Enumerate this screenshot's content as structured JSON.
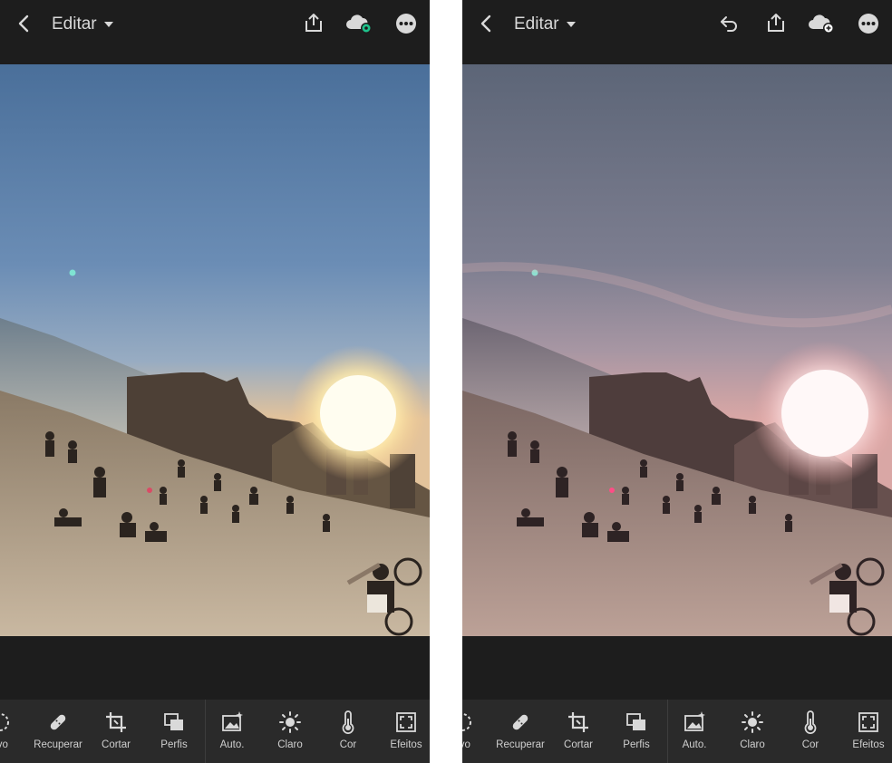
{
  "screens": [
    {
      "id": "original",
      "topbar": {
        "title": "Editar",
        "icons": [
          "back-arrow-icon",
          "share-icon",
          "cloud-sync-icon",
          "more-options-icon"
        ],
        "cloud_badge_color": "#1ec28b"
      },
      "toolbar": {
        "tools": [
          {
            "label": "tivo",
            "icon": "selective-icon"
          },
          {
            "label": "Recuperar",
            "icon": "healing-bandage-icon"
          },
          {
            "label": "Cortar",
            "icon": "crop-icon"
          },
          {
            "label": "Perfis",
            "icon": "profiles-icon"
          },
          {
            "label": "Auto.",
            "icon": "auto-enhance-icon"
          },
          {
            "label": "Claro",
            "icon": "light-sun-icon"
          },
          {
            "label": "Cor",
            "icon": "color-thermometer-icon"
          },
          {
            "label": "Efeitos",
            "icon": "effects-icon"
          }
        ]
      }
    },
    {
      "id": "edited",
      "topbar": {
        "title": "Editar",
        "icons": [
          "back-arrow-icon",
          "undo-icon",
          "share-icon",
          "cloud-add-icon",
          "more-options-icon"
        ],
        "cloud_badge_color": "#ffffff"
      },
      "toolbar": {
        "tools": [
          {
            "label": "tivo",
            "icon": "selective-icon"
          },
          {
            "label": "Recuperar",
            "icon": "healing-bandage-icon"
          },
          {
            "label": "Cortar",
            "icon": "crop-icon"
          },
          {
            "label": "Perfis",
            "icon": "profiles-icon"
          },
          {
            "label": "Auto.",
            "icon": "auto-enhance-icon"
          },
          {
            "label": "Claro",
            "icon": "light-sun-icon"
          },
          {
            "label": "Cor",
            "icon": "color-thermometer-icon"
          },
          {
            "label": "Efeitos",
            "icon": "effects-icon"
          }
        ]
      }
    }
  ],
  "colors": {
    "app_background": "#1d1d1d",
    "toolbar_background": "#2a2a2a",
    "icon_color": "#d9d9d9",
    "original_sky_top": "#4a6f9a",
    "edited_sky_top": "#5c6577"
  }
}
